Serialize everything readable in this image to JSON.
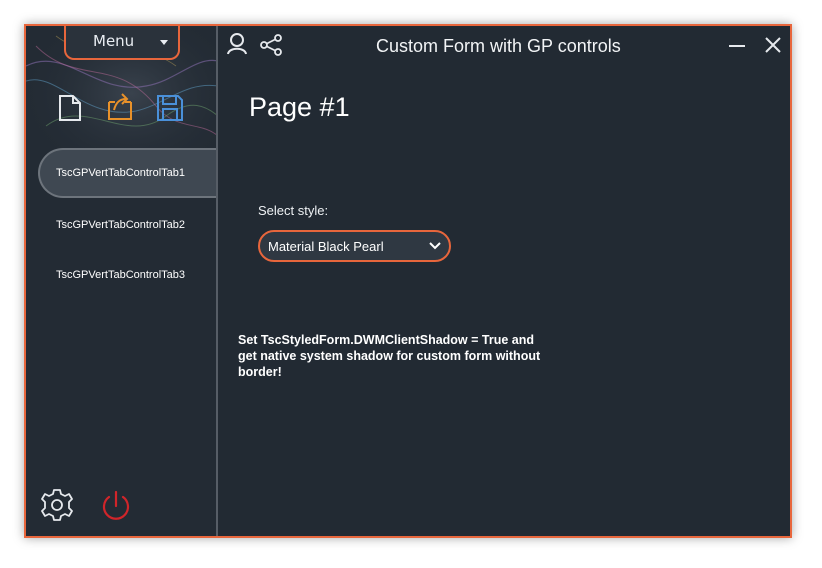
{
  "window": {
    "title": "Custom Form with GP controls",
    "accent_color": "#e8663c",
    "background_color": "#222a33"
  },
  "sidebar": {
    "menu_label": "Menu",
    "tools": [
      {
        "icon": "new-document-icon"
      },
      {
        "icon": "export-icon"
      },
      {
        "icon": "save-icon"
      }
    ],
    "tabs": [
      {
        "label": "TscGPVertTabControlTab1",
        "active": true
      },
      {
        "label": "TscGPVertTabControlTab2",
        "active": false
      },
      {
        "label": "TscGPVertTabControlTab3",
        "active": false
      }
    ],
    "footer_icons": [
      "settings-icon",
      "power-icon"
    ]
  },
  "titlebar": {
    "icons": [
      "user-icon",
      "share-icon",
      "minimize-icon",
      "close-icon"
    ]
  },
  "page": {
    "title": "Page #1",
    "select_label": "Select style:",
    "selected_style": "Material Black Pearl",
    "note": "Set TscStyledForm.DWMClientShadow = True and get native system shadow for custom form without border!"
  }
}
